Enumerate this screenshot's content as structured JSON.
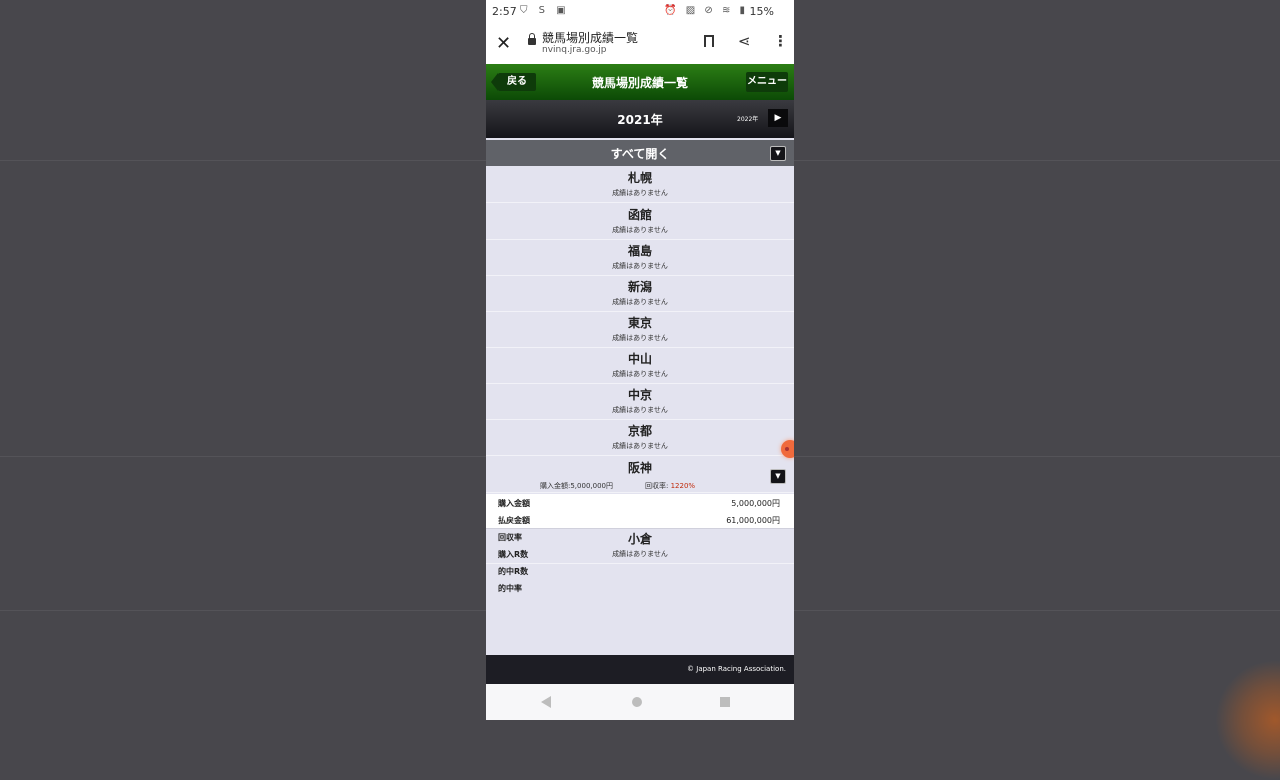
{
  "status_bar": {
    "time": "2:57",
    "left_icons": "⛉ S ▣",
    "right_icons": "⏰ ▨ ⊘ ≋ ▮",
    "battery": "15%"
  },
  "browser": {
    "page_title": "競馬場別成績一覧",
    "url": "nvinq.jra.go.jp",
    "close_glyph": "✕",
    "share_glyph": "⋖",
    "menu_glyph": "⋮"
  },
  "header": {
    "back_label": "戻る",
    "title": "競馬場別成績一覧",
    "menu_label": "メニュー"
  },
  "year_nav": {
    "current_year": "2021年",
    "next_year": "2022年",
    "next_glyph": "▶"
  },
  "expand_all": {
    "label": "すべて開く",
    "glyph": "▼"
  },
  "venues": [
    {
      "name": "札幌",
      "note": "成績はありません"
    },
    {
      "name": "函館",
      "note": "成績はありません"
    },
    {
      "name": "福島",
      "note": "成績はありません"
    },
    {
      "name": "新潟",
      "note": "成績はありません"
    },
    {
      "name": "東京",
      "note": "成績はありません"
    },
    {
      "name": "中山",
      "note": "成績はありません"
    },
    {
      "name": "中京",
      "note": "成績はありません"
    },
    {
      "name": "京都",
      "note": "成績はありません"
    }
  ],
  "hanshin": {
    "name": "阪神",
    "summary_purchase": "購入金額:5,000,000円",
    "summary_rate_label": "回収率:",
    "summary_rate_value": "1220%",
    "toggle_glyph": "▼"
  },
  "details": [
    {
      "label": "購入金額",
      "value": "5,000,000円"
    },
    {
      "label": "払戻金額",
      "value": "61,000,000円"
    },
    {
      "label": "回収率",
      "value": ""
    },
    {
      "label": "購入R数",
      "value": ""
    },
    {
      "label": "的中R数",
      "value": ""
    },
    {
      "label": "的中率",
      "value": ""
    }
  ],
  "ogura": {
    "name": "小倉",
    "note": "成績はありません"
  },
  "footer": {
    "copyright": "© Japan Racing Association."
  }
}
